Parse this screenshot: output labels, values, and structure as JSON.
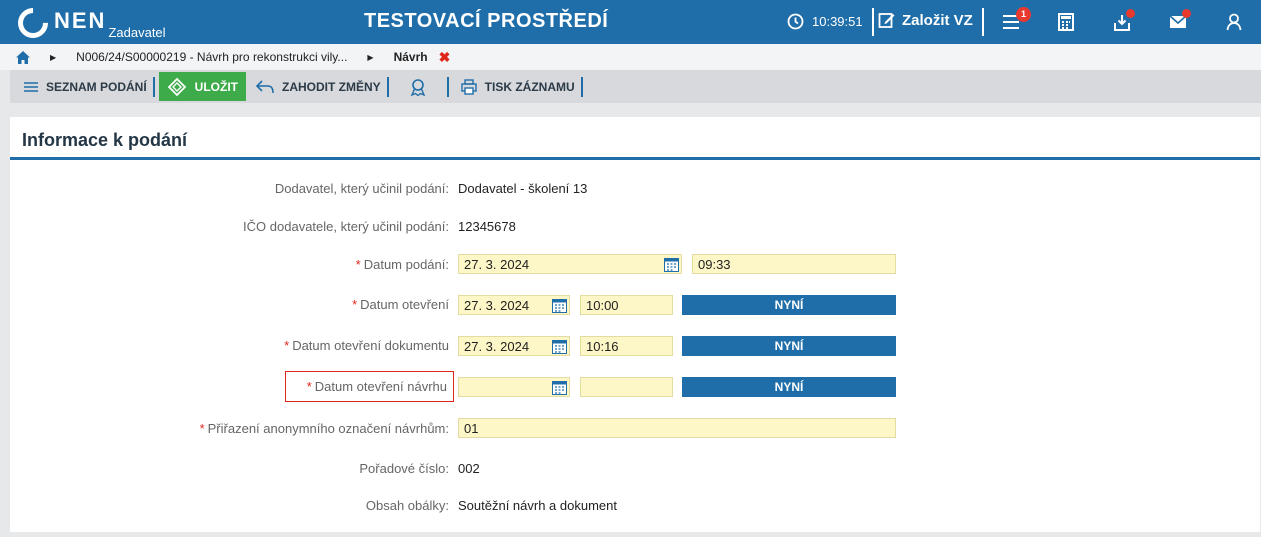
{
  "header": {
    "logo": "NEN",
    "logo_sub": "Zadavatel",
    "env_title": "TESTOVACÍ PROSTŘEDÍ",
    "clock": "10:39:51",
    "create_label": "Založit VZ",
    "menu_badge": "1"
  },
  "breadcrumb": {
    "items": [
      "N006/24/S00000219 - Návrh pro rekonstrukci vily...",
      "Návrh"
    ],
    "close": "✖"
  },
  "toolbar": {
    "list_label": "SEZNAM PODÁNÍ",
    "save_label": "ULOŽIT",
    "discard_label": "ZAHODIT ZMĚNY",
    "print_label": "TISK ZÁZNAMU"
  },
  "panel": {
    "title": "Informace k podání",
    "fields": {
      "supplier": {
        "label": "Dodavatel, který učinil podání:",
        "value": "Dodavatel - školení 13"
      },
      "ico": {
        "label": "IČO dodavatele, který učinil podání:",
        "value": "12345678"
      },
      "submission_date": {
        "label": "Datum podání:",
        "date": "27. 3. 2024",
        "time": "09:33"
      },
      "opening_date": {
        "label": "Datum otevření",
        "date": "27. 3. 2024",
        "time": "10:00",
        "now": "NYNÍ"
      },
      "doc_opening_date": {
        "label": "Datum otevření dokumentu",
        "date": "27. 3. 2024",
        "time": "10:16",
        "now": "NYNÍ"
      },
      "proposal_opening_date": {
        "label": "Datum otevření návrhu",
        "date": "",
        "time": "",
        "now": "NYNÍ"
      },
      "anon_mark": {
        "label": "Přiřazení anonymního označení návrhům:",
        "value": "01"
      },
      "order_no": {
        "label": "Pořadové číslo:",
        "value": "002"
      },
      "envelope": {
        "label": "Obsah obálky:",
        "value": "Soutěžní návrh a dokument"
      }
    }
  },
  "colors": {
    "brand": "#1f6eaa",
    "save": "#3eab4a",
    "required": "#e0261a",
    "field_bg": "#fdf6c7"
  }
}
